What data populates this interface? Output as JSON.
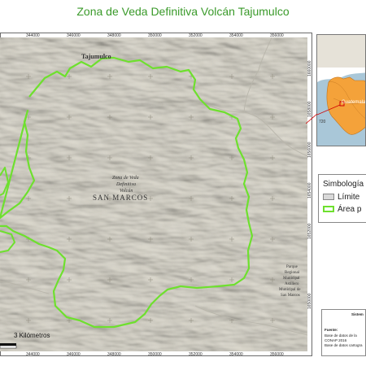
{
  "title": "Zona de Veda Definitiva Volcán Tajumulco",
  "map": {
    "top_ticks": [
      "344000",
      "346000",
      "348000",
      "350000",
      "352000",
      "354000",
      "356000"
    ],
    "bottom_ticks": [
      "344000",
      "346000",
      "348000",
      "350000",
      "352000",
      "354000",
      "356000"
    ],
    "right_ticks": [
      "1660000",
      "1658000",
      "1656000",
      "1654000",
      "1652000",
      "1650000"
    ],
    "places": {
      "tajumulco": "Tajumulco",
      "zona_line1": "Zona de Veda",
      "zona_line2": "Definitiva",
      "zona_line3": "Volcán",
      "department": "SAN MARCOS",
      "park_line1": "Parque",
      "park_line2": "Regional",
      "park_line3": "Municipal",
      "park_line4": "Astillero",
      "park_line5": "Municipal de",
      "park_line6": "San Marcos"
    },
    "scale_label": "3 Kilómetros",
    "boundary_color": "#6ee02e"
  },
  "inset": {
    "label": "Guatemala",
    "scale": "720"
  },
  "legend": {
    "title": "Simbología",
    "items": [
      {
        "label": "Límite",
        "swatch": "#d9d9d9"
      },
      {
        "label": "Área p",
        "swatch": "#ffffff"
      }
    ]
  },
  "info": {
    "header": "Sistem",
    "source_label": "Fuente:",
    "source_line1": "Base de datos de la",
    "source_line2": "CONAP 2016",
    "source_line3": "Base de datos cartogra"
  }
}
